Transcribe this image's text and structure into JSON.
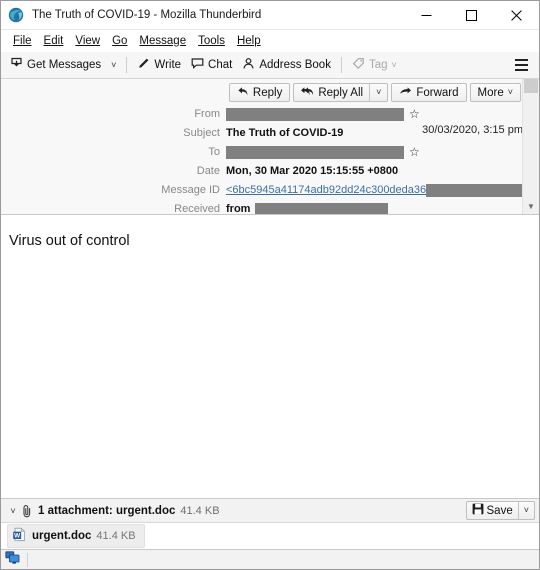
{
  "window": {
    "title": "The Truth of COVID-19 - Mozilla Thunderbird",
    "app_icon": "thunderbird-icon",
    "controls": {
      "minimize": "minimize-icon",
      "maximize": "maximize-icon",
      "close": "close-icon"
    }
  },
  "menubar": {
    "items": [
      {
        "label": "File",
        "accel": "F"
      },
      {
        "label": "Edit",
        "accel": "E"
      },
      {
        "label": "View",
        "accel": "V"
      },
      {
        "label": "Go",
        "accel": "G"
      },
      {
        "label": "Message",
        "accel": "M"
      },
      {
        "label": "Tools",
        "accel": "T"
      },
      {
        "label": "Help",
        "accel": "H"
      }
    ]
  },
  "toolbar": {
    "get_messages": "Get Messages",
    "get_messages_caret": "˅",
    "write": "Write",
    "chat": "Chat",
    "address_book": "Address Book",
    "tag": "Tag",
    "tag_caret": "˅",
    "tag_disabled": true,
    "app_menu": "app-menu-icon"
  },
  "message_actions": {
    "reply": "Reply",
    "reply_all": "Reply All",
    "reply_all_caret": "˅",
    "forward": "Forward",
    "more": "More",
    "more_caret": "˅"
  },
  "headers": {
    "from_label": "From",
    "from_value_redacted": true,
    "subject_label": "Subject",
    "subject_value": "The Truth of COVID-19",
    "date_display": "30/03/2020, 3:15 pm",
    "to_label": "To",
    "to_value_redacted": true,
    "date_label": "Date",
    "date_value": "Mon, 30 Mar 2020 15:15:55 +0800",
    "message_id_label": "Message ID",
    "message_id_value": "<6bc5945a41174adb92dd24c300deda36",
    "received_label": "Received",
    "received_value": "from",
    "star_icon": "star-icon",
    "redaction_color": "#808080",
    "link_color": "#3b6ea5"
  },
  "body": {
    "text": "Virus out of control"
  },
  "attachments": {
    "twisty": "˅",
    "clip_icon": "paperclip-icon",
    "summary": "1 attachment: urgent.doc",
    "total_size": "41.4 KB",
    "save_label": "Save",
    "save_caret": "˅",
    "items": [
      {
        "icon": "word-document-icon",
        "name": "urgent.doc",
        "size": "41.4 KB"
      }
    ]
  },
  "statusbar": {
    "icon": "network-status-icon",
    "text": ""
  }
}
